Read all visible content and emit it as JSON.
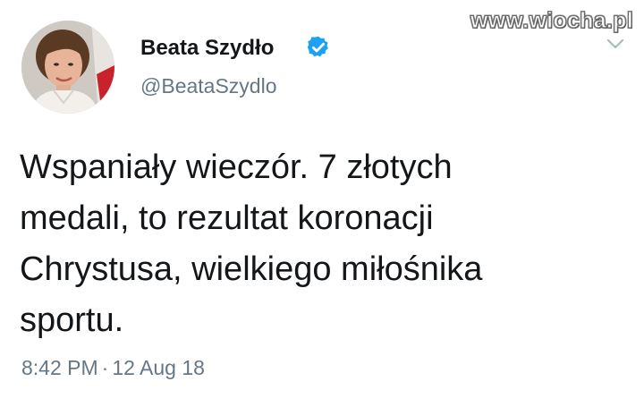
{
  "watermark": "www.wiocha.pl",
  "author": {
    "display_name": "Beata Szydło",
    "handle": "@BeataSzydlo",
    "verified": true
  },
  "tweet": {
    "text_lines": [
      "Wspaniały wieczór. 7 złotych",
      "medali, to rezultat koronacji",
      "Chrystusa, wielkiego miłośnika",
      "sportu."
    ],
    "time": "8:42 PM",
    "separator": "·",
    "date": "12 Aug 18"
  },
  "icons": {
    "verified": "verified-badge-icon",
    "menu": "chevron-down-icon"
  },
  "colors": {
    "verified_blue": "#1da1f2",
    "secondary_text": "#657786",
    "primary_text": "#14171a"
  }
}
